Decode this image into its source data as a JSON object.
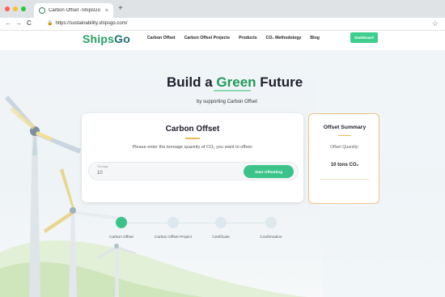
{
  "browser": {
    "tab_title": "Carbon Offset -ShipsGo",
    "tab_close": "×",
    "new_tab": "+",
    "url": "https://sustainability.shipsgo.com/",
    "back": "←",
    "forward": "→",
    "reload": "C",
    "lock": "🔒",
    "bookmark": "☆",
    "dot_colors": [
      "#ff5f57",
      "#febc2e",
      "#28c840"
    ]
  },
  "header": {
    "logo_ships": "Ships",
    "logo_go": "Go",
    "nav": [
      "Carbon Offset",
      "Carbon Offset Projects",
      "Products",
      "CO₂ Methodology",
      "Blog"
    ],
    "dashboard_button": "Dashboard"
  },
  "hero": {
    "title_part1": "Build a ",
    "title_green": "Green",
    "title_part2": " Future",
    "subtitle": "by supporting Carbon Offset"
  },
  "offset_card": {
    "title": "Carbon Offset",
    "prompt": "Please enter the tonnage quantity of CO₂ you want to offset.",
    "input_label": "Tonnage",
    "input_value": "10",
    "button": "Start Offsetting"
  },
  "summary": {
    "title": "Offset Summary",
    "label": "Offset Quantity:",
    "value": "10 tons CO₂"
  },
  "steps": [
    {
      "label": "Carbon Offset",
      "active": true
    },
    {
      "label": "Carbon Offset Project",
      "active": false
    },
    {
      "label": "Certificate",
      "active": false
    },
    {
      "label": "Confirmation",
      "active": false
    }
  ],
  "colors": {
    "brand_green": "#26a064",
    "accent_green": "#3cc38a",
    "accent_orange": "#f0b95a"
  }
}
